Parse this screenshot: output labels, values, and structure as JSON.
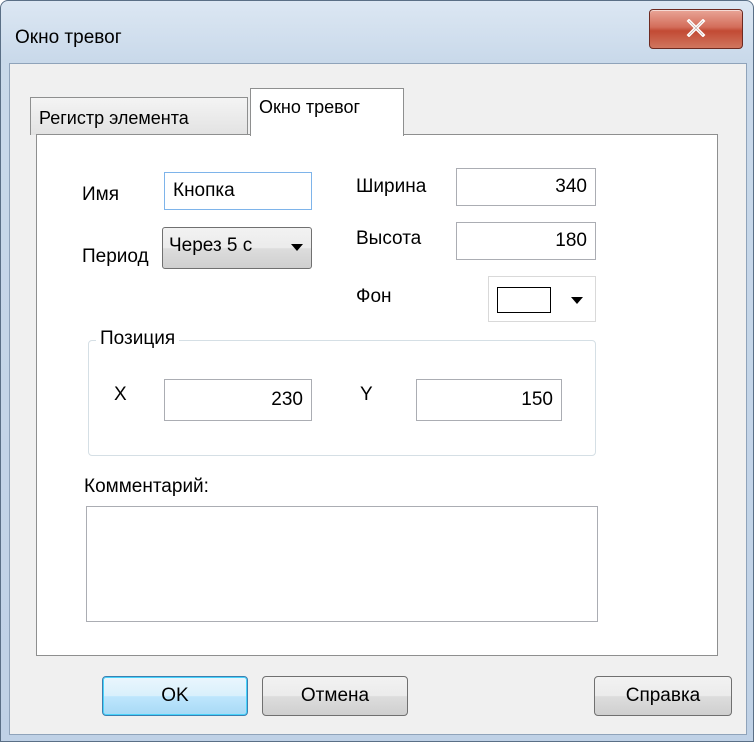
{
  "window": {
    "title": "Окно тревог"
  },
  "tabs": [
    {
      "label": "Регистр элемента",
      "active": false
    },
    {
      "label": "Окно тревог",
      "active": true
    }
  ],
  "form": {
    "name": {
      "label": "Имя",
      "value": "Кнопка"
    },
    "period": {
      "label": "Период",
      "value": "Через 5 с"
    },
    "width": {
      "label": "Ширина",
      "value": "340"
    },
    "height": {
      "label": "Высота",
      "value": "180"
    },
    "background": {
      "label": "Фон",
      "color": "#ffffff"
    },
    "position": {
      "title": "Позиция",
      "x": {
        "label": "X",
        "value": "230"
      },
      "y": {
        "label": "Y",
        "value": "150"
      }
    },
    "comment": {
      "label": "Комментарий:",
      "value": ""
    }
  },
  "buttons": {
    "ok": "OK",
    "cancel": "Отмена",
    "help": "Справка"
  },
  "icons": {
    "close": "close-icon",
    "dropdown": "chevron-down-icon"
  },
  "colors": {
    "close_button": "#c24a34",
    "focus_border": "#7eb4ea",
    "default_button": "#bee6fd"
  }
}
